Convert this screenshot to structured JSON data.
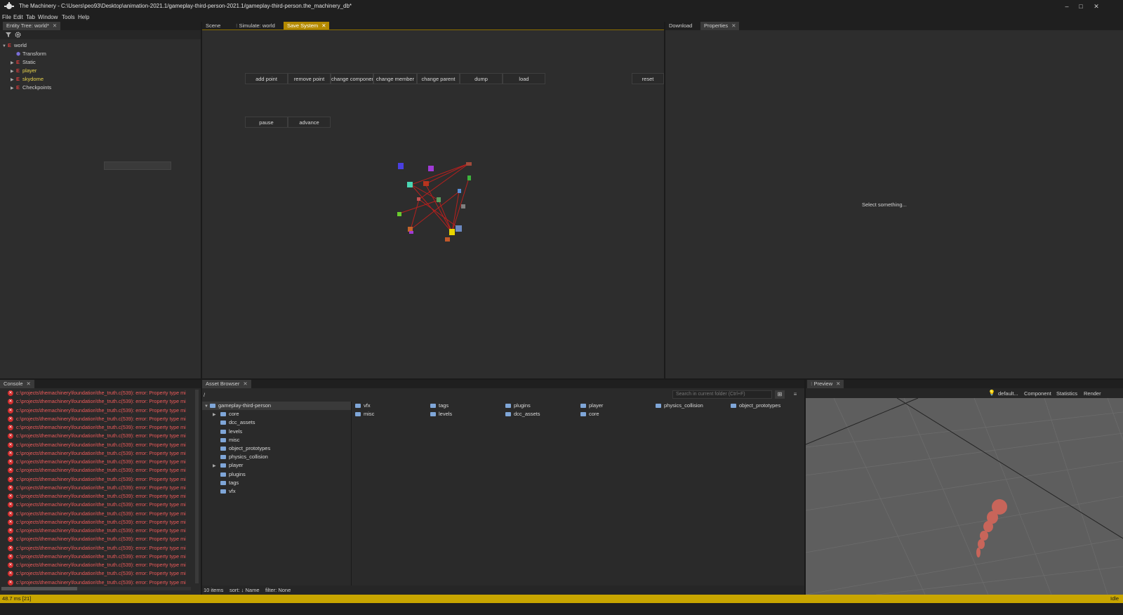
{
  "window": {
    "title": "The Machinery - C:\\Users\\peo93\\Desktop\\animation-2021.1/gameplay-third-person-2021.1/gameplay-third-person.the_machinery_db*",
    "minimize": "–",
    "maximize": "□",
    "close": "✕"
  },
  "menu": [
    "File",
    "Edit",
    "Tab",
    "Window",
    "Tools",
    "Help"
  ],
  "entity_tree": {
    "tab_label": "Entity Tree: world*",
    "rows": [
      {
        "label": "world"
      },
      {
        "label": "Transform"
      },
      {
        "label": "Static"
      },
      {
        "label": "player"
      },
      {
        "label": "skydome"
      },
      {
        "label": "Checkpoints"
      }
    ]
  },
  "center": {
    "tabs": [
      "Scene",
      "Simulate: world",
      "Save System"
    ],
    "buttons_row1": [
      "add point",
      "remove point",
      "change component",
      "change member",
      "change parent",
      "dump",
      "load"
    ],
    "reset": "reset",
    "buttons_row2": [
      "pause",
      "advance"
    ]
  },
  "right": {
    "tabs": [
      "Download",
      "Properties"
    ],
    "empty_message": "Select something..."
  },
  "console": {
    "tab_label": "Console",
    "error_text": "c:\\projects\\themachinery\\foundation\\the_truth.c(539): error: Property type mi",
    "error_count": 23
  },
  "asset_browser": {
    "tab_label": "Asset Browser",
    "path": "/",
    "search_placeholder": "Search in current folder (Ctrl+F)",
    "tree_root": "gameplay-third-person",
    "tree_items": [
      "core",
      "dcc_assets",
      "levels",
      "misc",
      "object_prototypes",
      "physics_collision",
      "player",
      "plugins",
      "tags",
      "vfx"
    ],
    "grid_items": [
      "vfx",
      "tags",
      "plugins",
      "player",
      "physics_collision",
      "object_prototypes",
      "misc",
      "levels",
      "dcc_assets",
      "core"
    ],
    "status": {
      "items": "10 items",
      "sort": "sort: ↓ Name",
      "filter": "filter: None"
    }
  },
  "preview": {
    "tab_label": "Preview",
    "toolbar": [
      "default...",
      "Component",
      "Statistics",
      "Render"
    ]
  },
  "statusbar": {
    "left": "48.7 ms [21]",
    "right": "Idle"
  },
  "colors": {
    "accent": "#c9a600",
    "error": "#ee5a5a",
    "folder": "#7fa6d8",
    "entity": "#d43c3c"
  }
}
